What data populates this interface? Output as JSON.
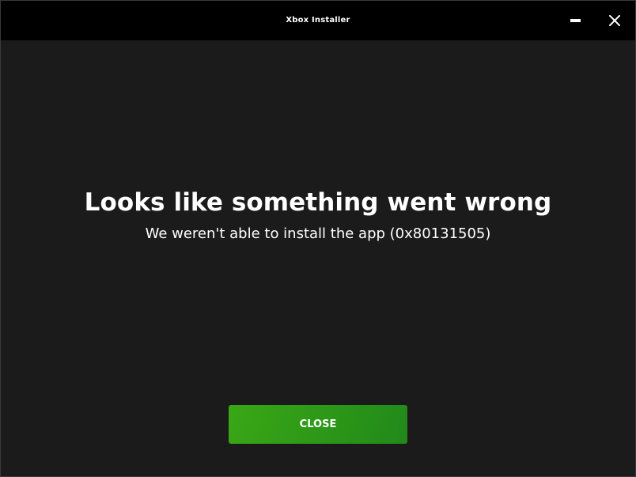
{
  "window": {
    "title": "Xbox Installer"
  },
  "error": {
    "headline": "Looks like something went wrong",
    "message": "We weren't able to install the app (0x80131505)"
  },
  "actions": {
    "close_label": "CLOSE"
  },
  "icons": {
    "minimize": "minimize-icon",
    "close": "close-icon"
  },
  "colors": {
    "titlebar": "#000000",
    "background": "#1b1b1c",
    "text": "#ffffff",
    "accent": "#2f9a17"
  }
}
